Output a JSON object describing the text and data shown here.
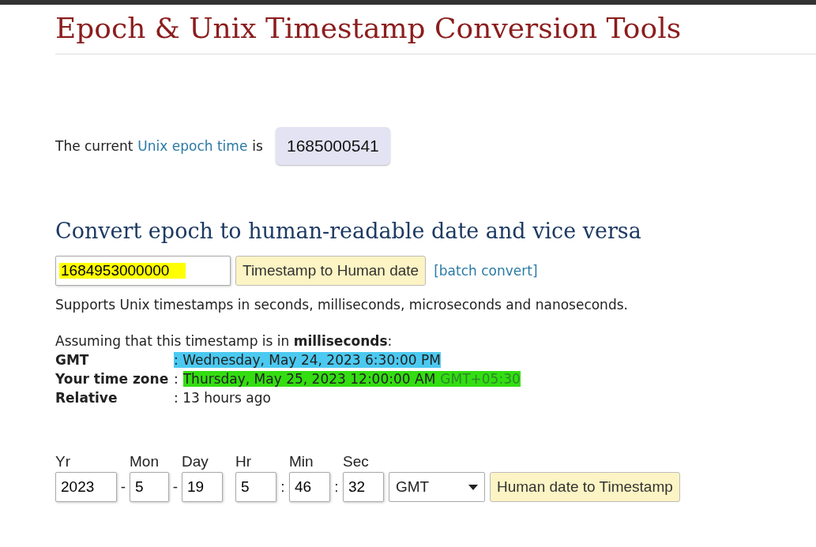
{
  "title": "Epoch & Unix Timestamp Conversion Tools",
  "current": {
    "prefix": "The current",
    "link": "Unix epoch time",
    "suffix": "is",
    "value": "1685000541"
  },
  "convert": {
    "heading": "Convert epoch to human-readable date and vice versa",
    "input": {
      "value": "1684953000000",
      "color": "#ffff00"
    },
    "button": "Timestamp to Human date",
    "batch_link": "[batch convert]",
    "note": "Supports Unix timestamps in seconds, milliseconds, microseconds and nanoseconds.",
    "assumption": "Assuming that this timestamp is in **milliseconds**:",
    "results": [
      {
        "label": "GMT",
        "value": ": Wednesday, May 24, 2023 6:30:00 PM",
        "color": "#4cc9f0"
      },
      {
        "label": "Your time zone",
        "prefix": ":",
        "value": "Thursday, May 25, 2023 12:00:00 AM",
        "suffix": "GMT+05:30",
        "color": "#33dd11"
      },
      {
        "label": "Relative",
        "value": ": 13 hours ago"
      }
    ]
  },
  "human": {
    "fields": [
      {
        "label": "Yr",
        "value": "2023",
        "sep": "-"
      },
      {
        "label": "Mon",
        "value": "5",
        "sep": "-"
      },
      {
        "label": "Day",
        "value": "19"
      },
      {
        "label": "Hr",
        "value": "5",
        "sep": ":"
      },
      {
        "label": "Min",
        "value": "46",
        "sep": ":"
      },
      {
        "label": "Sec",
        "value": "32"
      }
    ],
    "timezone": "GMT",
    "button": "Human date to Timestamp"
  }
}
